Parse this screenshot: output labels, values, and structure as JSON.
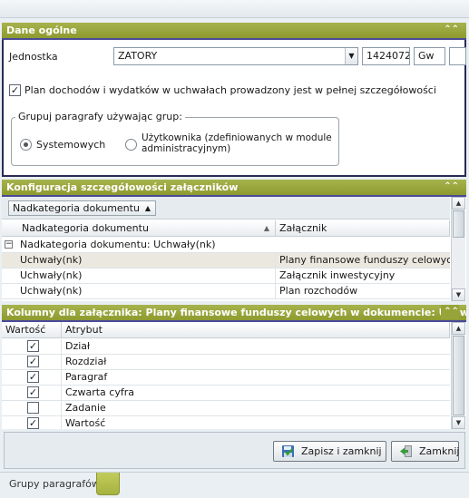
{
  "panel_general": {
    "title": "Dane ogólne",
    "jednostka_label": "Jednostka",
    "jednostka_value": "ZATORY",
    "code_value": "1424072",
    "type_value": "Gw",
    "extra_value": "",
    "plan_checkbox_label": "Plan dochodów i wydatków w uchwałach prowadzony jest w pełnej szczegółowości",
    "plan_checkbox_checked": true,
    "group_title": "Grupuj paragrafy używając grup:",
    "radio_system": "Systemowych",
    "radio_user": "Użytkownika (zdefiniowanych w module administracyjnym)",
    "selected_radio": "system"
  },
  "panel_config": {
    "title": "Konfiguracja szczegółowości załączników",
    "group_chip": "Nadkategoria dokumentu",
    "columns": [
      "Nadkategoria dokumentu",
      "Załącznik"
    ],
    "group_row": "Nadkategoria dokumentu:  Uchwały(nk)",
    "rows": [
      {
        "category": "Uchwały(nk)",
        "attachment": "Plany finansowe funduszy celowych",
        "selected": true
      },
      {
        "category": "Uchwały(nk)",
        "attachment": "Załącznik inwestycyjny",
        "selected": false
      },
      {
        "category": "Uchwały(nk)",
        "attachment": "Plan rozchodów",
        "selected": false
      }
    ]
  },
  "panel_columns": {
    "title": "Kolumny dla załącznika: Plany finansowe funduszy celowych w dokumencie: Uchwały(nk)",
    "columns": [
      "Wartość",
      "Atrybut"
    ],
    "rows": [
      {
        "checked": true,
        "attribute": "Dział"
      },
      {
        "checked": true,
        "attribute": "Rozdział"
      },
      {
        "checked": true,
        "attribute": "Paragraf"
      },
      {
        "checked": true,
        "attribute": "Czwarta cyfra"
      },
      {
        "checked": false,
        "attribute": "Zadanie"
      },
      {
        "checked": true,
        "attribute": "Wartość"
      }
    ]
  },
  "buttons": {
    "save_close": "Zapisz i zamknij",
    "close": "Zamknij"
  },
  "bottom_tab": "Grupy paragrafów",
  "colors": {
    "panel_header": "#97a43a",
    "panel_accent": "#4a4a99",
    "selected_row": "#ebe9df"
  }
}
